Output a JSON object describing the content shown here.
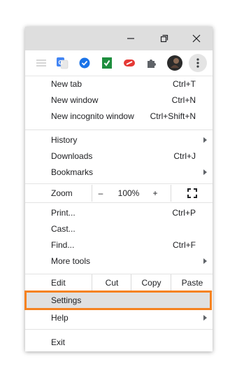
{
  "window_controls": {
    "minimize_icon": "minimize-icon",
    "restore_icon": "restore-icon",
    "close_icon": "close-icon"
  },
  "extensions": [
    "reading-list-icon",
    "google-translate-icon",
    "check-shield-icon",
    "green-check-icon",
    "red-logo-icon",
    "puzzle-icon"
  ],
  "menu": {
    "new_tab": {
      "label": "New tab",
      "shortcut": "Ctrl+T"
    },
    "new_window": {
      "label": "New window",
      "shortcut": "Ctrl+N"
    },
    "new_incognito": {
      "label": "New incognito window",
      "shortcut": "Ctrl+Shift+N"
    },
    "history": {
      "label": "History"
    },
    "downloads": {
      "label": "Downloads",
      "shortcut": "Ctrl+J"
    },
    "bookmarks": {
      "label": "Bookmarks"
    },
    "zoom": {
      "label": "Zoom",
      "minus": "–",
      "value": "100%",
      "plus": "+"
    },
    "print": {
      "label": "Print...",
      "shortcut": "Ctrl+P"
    },
    "cast": {
      "label": "Cast..."
    },
    "find": {
      "label": "Find...",
      "shortcut": "Ctrl+F"
    },
    "more_tools": {
      "label": "More tools"
    },
    "edit": {
      "label": "Edit",
      "cut": "Cut",
      "copy": "Copy",
      "paste": "Paste"
    },
    "settings": {
      "label": "Settings"
    },
    "help": {
      "label": "Help"
    },
    "exit": {
      "label": "Exit"
    }
  },
  "colors": {
    "highlight_border": "#f58220",
    "titlebar": "#dedede"
  }
}
